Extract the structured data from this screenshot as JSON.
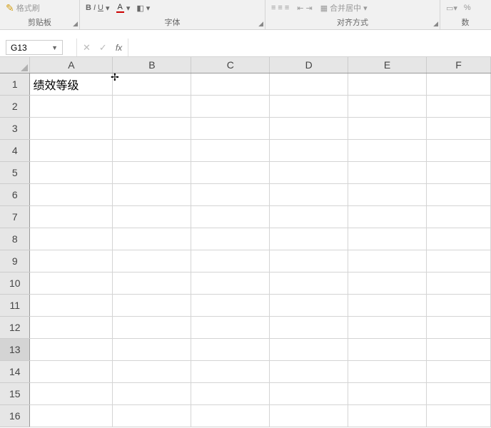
{
  "ribbon": {
    "clipboard": {
      "format_painter_label": "格式刷",
      "group_label": "剪贴板"
    },
    "font": {
      "group_label": "字体",
      "bold": "B",
      "italic": "I",
      "underline": "U"
    },
    "alignment": {
      "group_label": "对齐方式",
      "merge_label": "合并居中"
    },
    "number": {
      "group_label": "数"
    }
  },
  "formula_bar": {
    "name_box": "G13",
    "cancel": "✕",
    "enter": "✓",
    "fx": "fx",
    "value": ""
  },
  "columns": [
    "A",
    "B",
    "C",
    "D",
    "E",
    "F"
  ],
  "rows": [
    1,
    2,
    3,
    4,
    5,
    6,
    7,
    8,
    9,
    10,
    11,
    12,
    13,
    14,
    15,
    16
  ],
  "selected_row": 13,
  "cells": {
    "A1": "绩效等级"
  }
}
